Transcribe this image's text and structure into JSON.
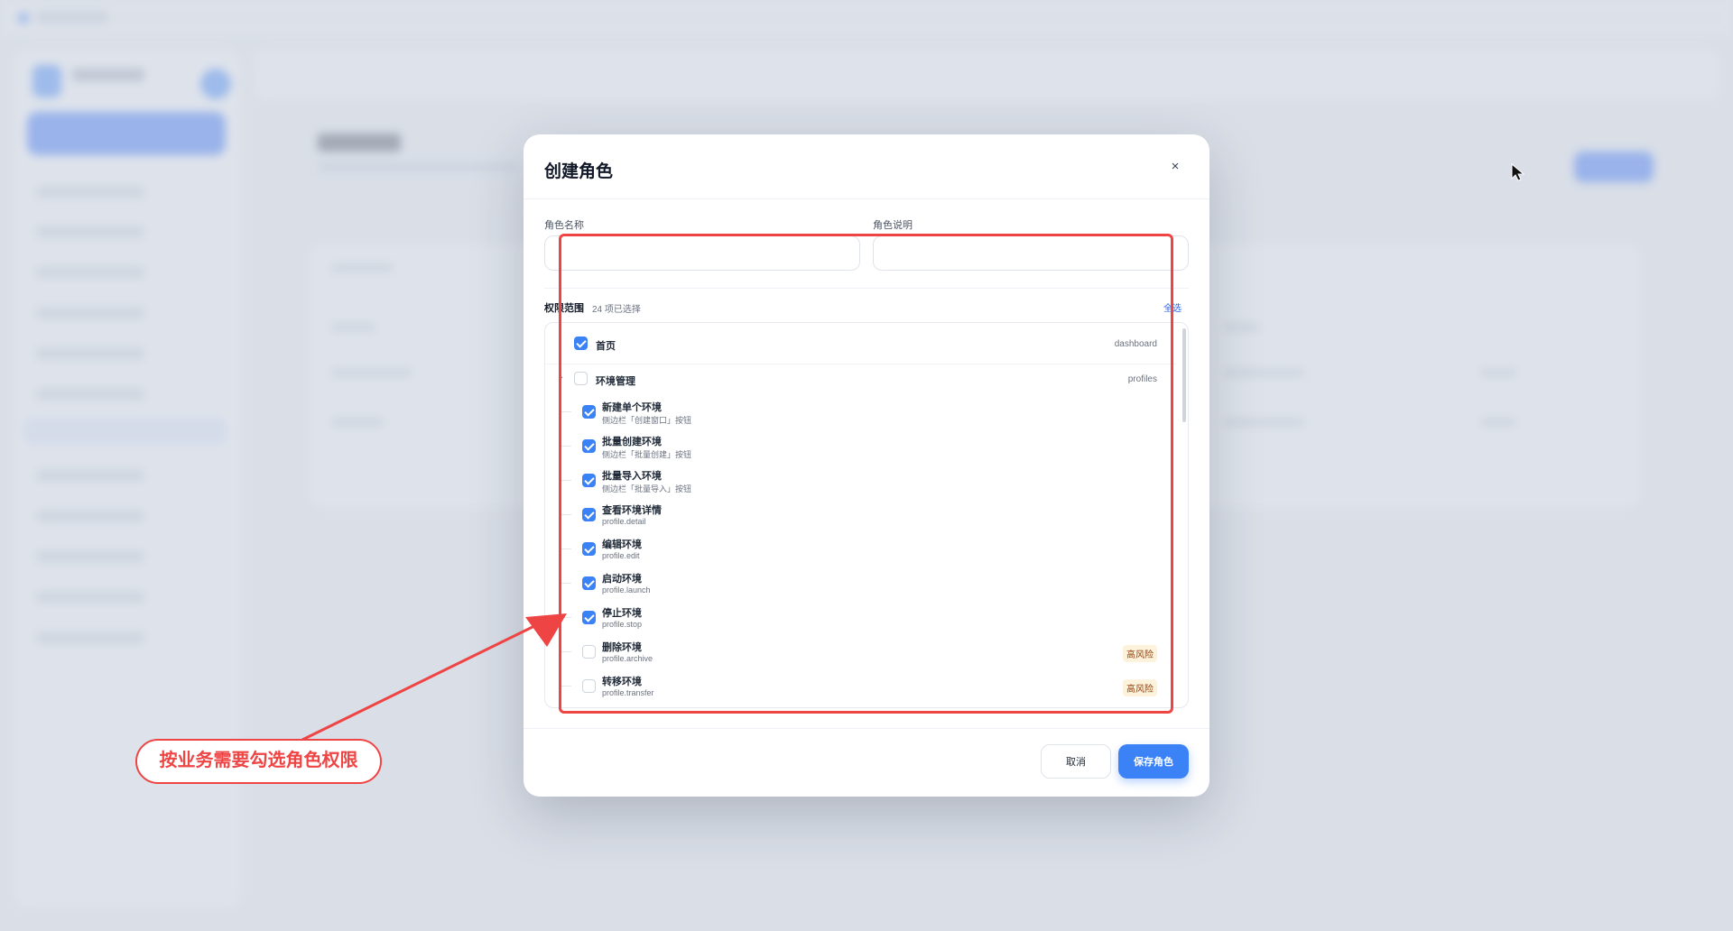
{
  "modal": {
    "title": "创建角色",
    "close_symbol": "×",
    "role_name_label": "角色名称",
    "role_name_value": "",
    "role_desc_label": "角色说明",
    "role_desc_value": "",
    "perm_label": "权限范围",
    "perm_count": "24 项已选择",
    "select_all": "全选",
    "tree": {
      "top": {
        "name": "首页",
        "key": "dashboard",
        "checked": true
      },
      "group": {
        "name": "环境管理",
        "key": "profiles",
        "checked": false,
        "expanded": true
      },
      "children": [
        {
          "name": "新建单个环境",
          "desc": "侧边栏「创建窗口」按钮",
          "checked": true,
          "risk": ""
        },
        {
          "name": "批量创建环境",
          "desc": "侧边栏「批量创建」按钮",
          "checked": true,
          "risk": ""
        },
        {
          "name": "批量导入环境",
          "desc": "侧边栏「批量导入」按钮",
          "checked": true,
          "risk": ""
        },
        {
          "name": "查看环境详情",
          "desc": "profile.detail",
          "checked": true,
          "risk": ""
        },
        {
          "name": "编辑环境",
          "desc": "profile.edit",
          "checked": true,
          "risk": ""
        },
        {
          "name": "启动环境",
          "desc": "profile.launch",
          "checked": true,
          "risk": ""
        },
        {
          "name": "停止环境",
          "desc": "profile.stop",
          "checked": true,
          "risk": ""
        },
        {
          "name": "删除环境",
          "desc": "profile.archive",
          "checked": false,
          "risk": "高风险"
        },
        {
          "name": "转移环境",
          "desc": "profile.transfer",
          "checked": false,
          "risk": "高风险"
        }
      ]
    },
    "cancel_label": "取消",
    "save_label": "保存角色"
  },
  "annotation": {
    "callout_text": "按业务需要勾选角色权限",
    "color": "#ef4444"
  },
  "colors": {
    "accent": "#3b82f6",
    "risk_bg": "#fdf3dc",
    "risk_text": "#92400e"
  },
  "icons": [
    "close-icon",
    "chevron-down-icon",
    "checkbox-icon",
    "mouse-cursor-icon",
    "arrow-annotation-icon"
  ]
}
